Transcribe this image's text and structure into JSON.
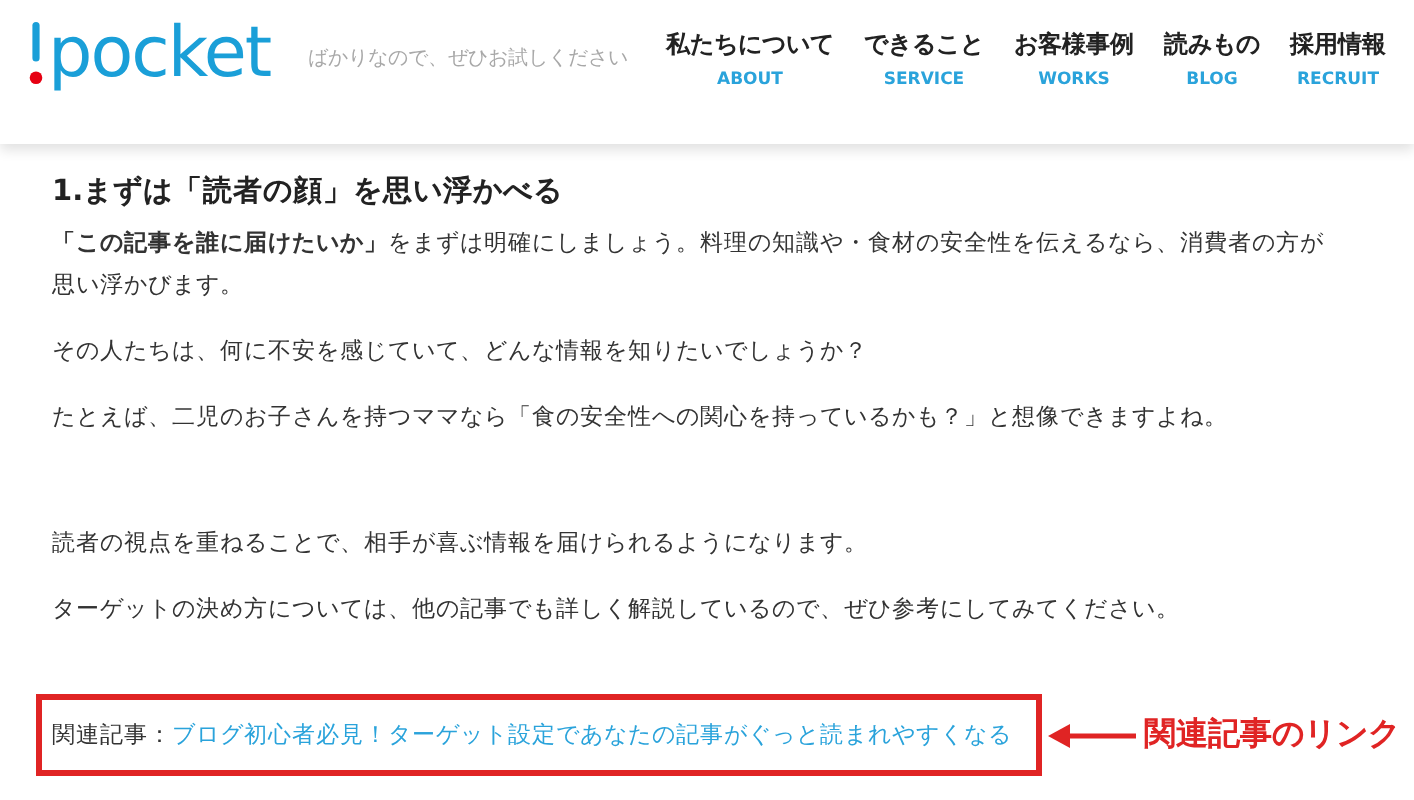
{
  "background_text": "ばかりなので、ぜひお試しください",
  "logo": {
    "text": "pocket"
  },
  "nav": [
    {
      "label": "私たちについて",
      "sub": "ABOUT"
    },
    {
      "label": "できること",
      "sub": "SERVICE"
    },
    {
      "label": "お客様事例",
      "sub": "WORKS"
    },
    {
      "label": "読みもの",
      "sub": "BLOG"
    },
    {
      "label": "採用情報",
      "sub": "RECRUIT"
    }
  ],
  "article": {
    "heading": "1.まずは「読者の顔」を思い浮かべる",
    "paragraphs": [
      "**「この記事を誰に届けたいか」**をまずは明確にしましょう。料理の知識や・食材の安全性を伝えるなら、消費者の方が思い浮かびます。",
      "その人たちは、何に不安を感じていて、どんな情報を知りたいでしょうか？",
      "たとえば、二児のお子さんを持つママなら「食の安全性への関心を持っているかも？」と想像できますよね。",
      "読者の視点を重ねることで、相手が喜ぶ情報を届けられるようになります。",
      "ターゲットの決め方については、他の記事でも詳しく解説しているので、ぜひ参考にしてみてください。"
    ],
    "related": {
      "prefix": "関連記事：",
      "link": "ブログ初心者必見！ターゲット設定であなたの記事がぐっと読まれやすくなる"
    }
  },
  "annotation": {
    "label": "関連記事のリンク"
  }
}
